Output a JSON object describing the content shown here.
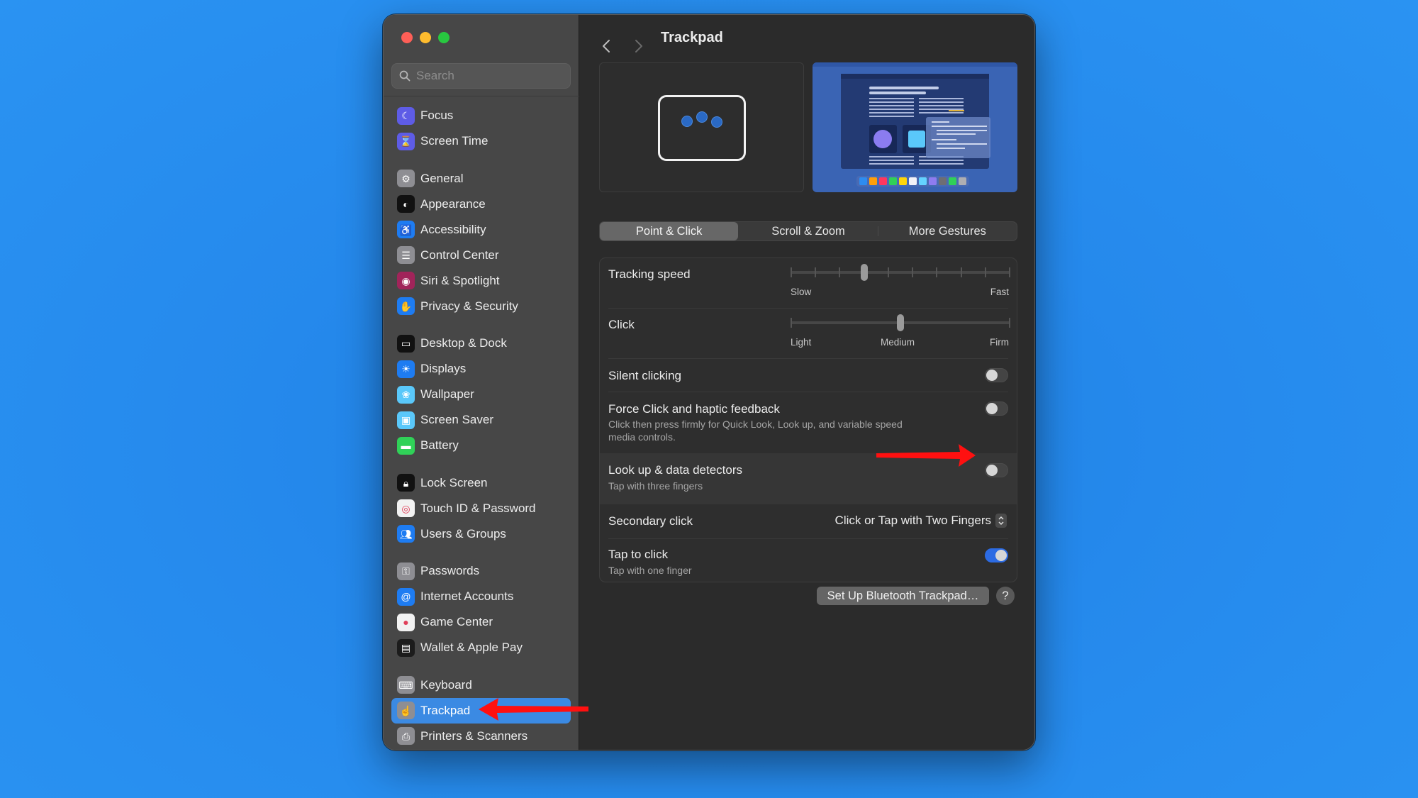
{
  "window": {
    "traffic_lights": [
      "close",
      "minimize",
      "zoom"
    ],
    "title": "Trackpad"
  },
  "sidebar": {
    "search_placeholder": "Search",
    "groups": [
      [
        {
          "label": "Focus",
          "icon": "moon-icon",
          "color": "#5e5ce6",
          "glyph": "☾"
        },
        {
          "label": "Screen Time",
          "icon": "hourglass-icon",
          "color": "#5e5ce6",
          "glyph": "⌛"
        }
      ],
      [
        {
          "label": "General",
          "icon": "gear-icon",
          "color": "#8e8e93",
          "glyph": "⚙"
        },
        {
          "label": "Appearance",
          "icon": "appearance-icon",
          "color": "#111111",
          "glyph": "◐"
        },
        {
          "label": "Accessibility",
          "icon": "accessibility-icon",
          "color": "#1e7cf2",
          "glyph": "♿"
        },
        {
          "label": "Control Center",
          "icon": "control-center-icon",
          "color": "#8e8e93",
          "glyph": "☰"
        },
        {
          "label": "Siri & Spotlight",
          "icon": "siri-icon",
          "color": "#a1245a",
          "glyph": "◉"
        },
        {
          "label": "Privacy & Security",
          "icon": "hand-icon",
          "color": "#1e7cf2",
          "glyph": "✋"
        }
      ],
      [
        {
          "label": "Desktop & Dock",
          "icon": "dock-icon",
          "color": "#111111",
          "glyph": "▭"
        },
        {
          "label": "Displays",
          "icon": "sun-icon",
          "color": "#1e7cf2",
          "glyph": "☀"
        },
        {
          "label": "Wallpaper",
          "icon": "flower-icon",
          "color": "#5ac8fa",
          "glyph": "❀"
        },
        {
          "label": "Screen Saver",
          "icon": "screen-saver-icon",
          "color": "#5ac8fa",
          "glyph": "▣"
        },
        {
          "label": "Battery",
          "icon": "battery-icon",
          "color": "#30d158",
          "glyph": "▬"
        }
      ],
      [
        {
          "label": "Lock Screen",
          "icon": "lock-icon",
          "color": "#111111",
          "glyph": "🔒︎"
        },
        {
          "label": "Touch ID & Password",
          "icon": "fingerprint-icon",
          "color": "#f2f2f2",
          "glyph": "◎"
        },
        {
          "label": "Users & Groups",
          "icon": "users-icon",
          "color": "#1e7cf2",
          "glyph": "👥︎"
        }
      ],
      [
        {
          "label": "Passwords",
          "icon": "key-icon",
          "color": "#8e8e93",
          "glyph": "⚿"
        },
        {
          "label": "Internet Accounts",
          "icon": "at-icon",
          "color": "#1e7cf2",
          "glyph": "@"
        },
        {
          "label": "Game Center",
          "icon": "game-center-icon",
          "color": "#f2f2f2",
          "glyph": "●"
        },
        {
          "label": "Wallet & Apple Pay",
          "icon": "wallet-icon",
          "color": "#1c1c1c",
          "glyph": "▤"
        }
      ],
      [
        {
          "label": "Keyboard",
          "icon": "keyboard-icon",
          "color": "#8e8e93",
          "glyph": "⌨"
        },
        {
          "label": "Trackpad",
          "icon": "trackpad-icon",
          "color": "#8e8e93",
          "glyph": "☝",
          "selected": true
        },
        {
          "label": "Printers & Scanners",
          "icon": "printer-icon",
          "color": "#8e8e93",
          "glyph": "⎙"
        }
      ]
    ]
  },
  "main": {
    "title": "Trackpad",
    "tabs": [
      {
        "label": "Point & Click",
        "active": true
      },
      {
        "label": "Scroll & Zoom",
        "active": false
      },
      {
        "label": "More Gestures",
        "active": false
      }
    ],
    "settings": {
      "tracking_speed": {
        "label": "Tracking speed",
        "min_label": "Slow",
        "max_label": "Fast",
        "ticks": 10,
        "value_index": 3
      },
      "click": {
        "label": "Click",
        "labels": [
          "Light",
          "Medium",
          "Firm"
        ],
        "value_index": 1
      },
      "silent_clicking": {
        "label": "Silent clicking",
        "on": false
      },
      "force_click": {
        "label": "Force Click and haptic feedback",
        "description_line1": "Click then press firmly for Quick Look, Look up, and variable speed",
        "description_line2": "media controls.",
        "on": false
      },
      "look_up": {
        "label": "Look up & data detectors",
        "description": "Tap with three fingers",
        "on": false
      },
      "secondary_click": {
        "label": "Secondary click",
        "value": "Click or Tap with Two Fingers"
      },
      "tap_to_click": {
        "label": "Tap to click",
        "description": "Tap with one finger",
        "on": true
      }
    },
    "setup_bluetooth_label": "Set Up Bluetooth Trackpad…",
    "help_label": "?"
  },
  "colors": {
    "accent": "#2c6be3",
    "sidebar_selected": "#3b8ae3",
    "annotation_arrow": "#ff0000"
  },
  "preview": {
    "dock_colors": [
      "#2d8cf0",
      "#ff9f0a",
      "#ff375f",
      "#30d158",
      "#ffd60a",
      "#f2f2f7",
      "#64d2ff",
      "#8e7cf0",
      "#6e6e73",
      "#30d158",
      "#aeaeb2"
    ]
  }
}
